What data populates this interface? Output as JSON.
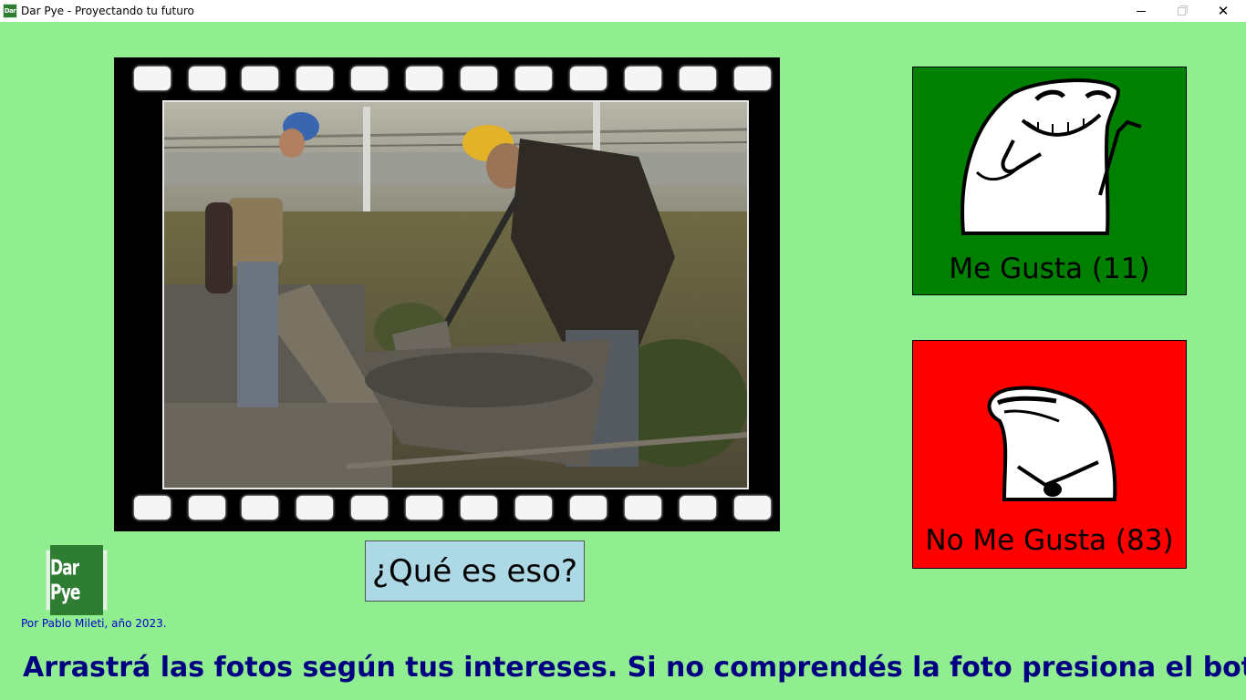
{
  "window": {
    "app_icon_text": "Dar Pye",
    "title": "Dar Pye - Proyectando tu futuro",
    "minimize_icon": "minimize-icon",
    "maximize_icon": "maximize-icon",
    "close_icon": "close-icon",
    "close_glyph": "✕"
  },
  "main_image": {
    "description_icon": "photo",
    "frame_style": "film-strip"
  },
  "panels": {
    "like": {
      "label": "Me Gusta (11)",
      "color": "#008000",
      "icon": "smiling-meme-icon"
    },
    "dislike": {
      "label": "No Me Gusta (83)",
      "color": "#ff0000",
      "icon": "sad-meme-icon"
    }
  },
  "buttons": {
    "que_es_eso": "¿Qué es eso?",
    "que_es_eso_color": "#add8e6"
  },
  "logo": {
    "text": "Dar Pye"
  },
  "credit": "Por Pablo Mileti, año 2023.",
  "instruction": "Arrastrá las fotos según tus intereses. Si no comprendés la foto presiona el botón",
  "colors": {
    "background": "#90ee90",
    "instruction": "#000080",
    "credit": "#0000cc"
  }
}
